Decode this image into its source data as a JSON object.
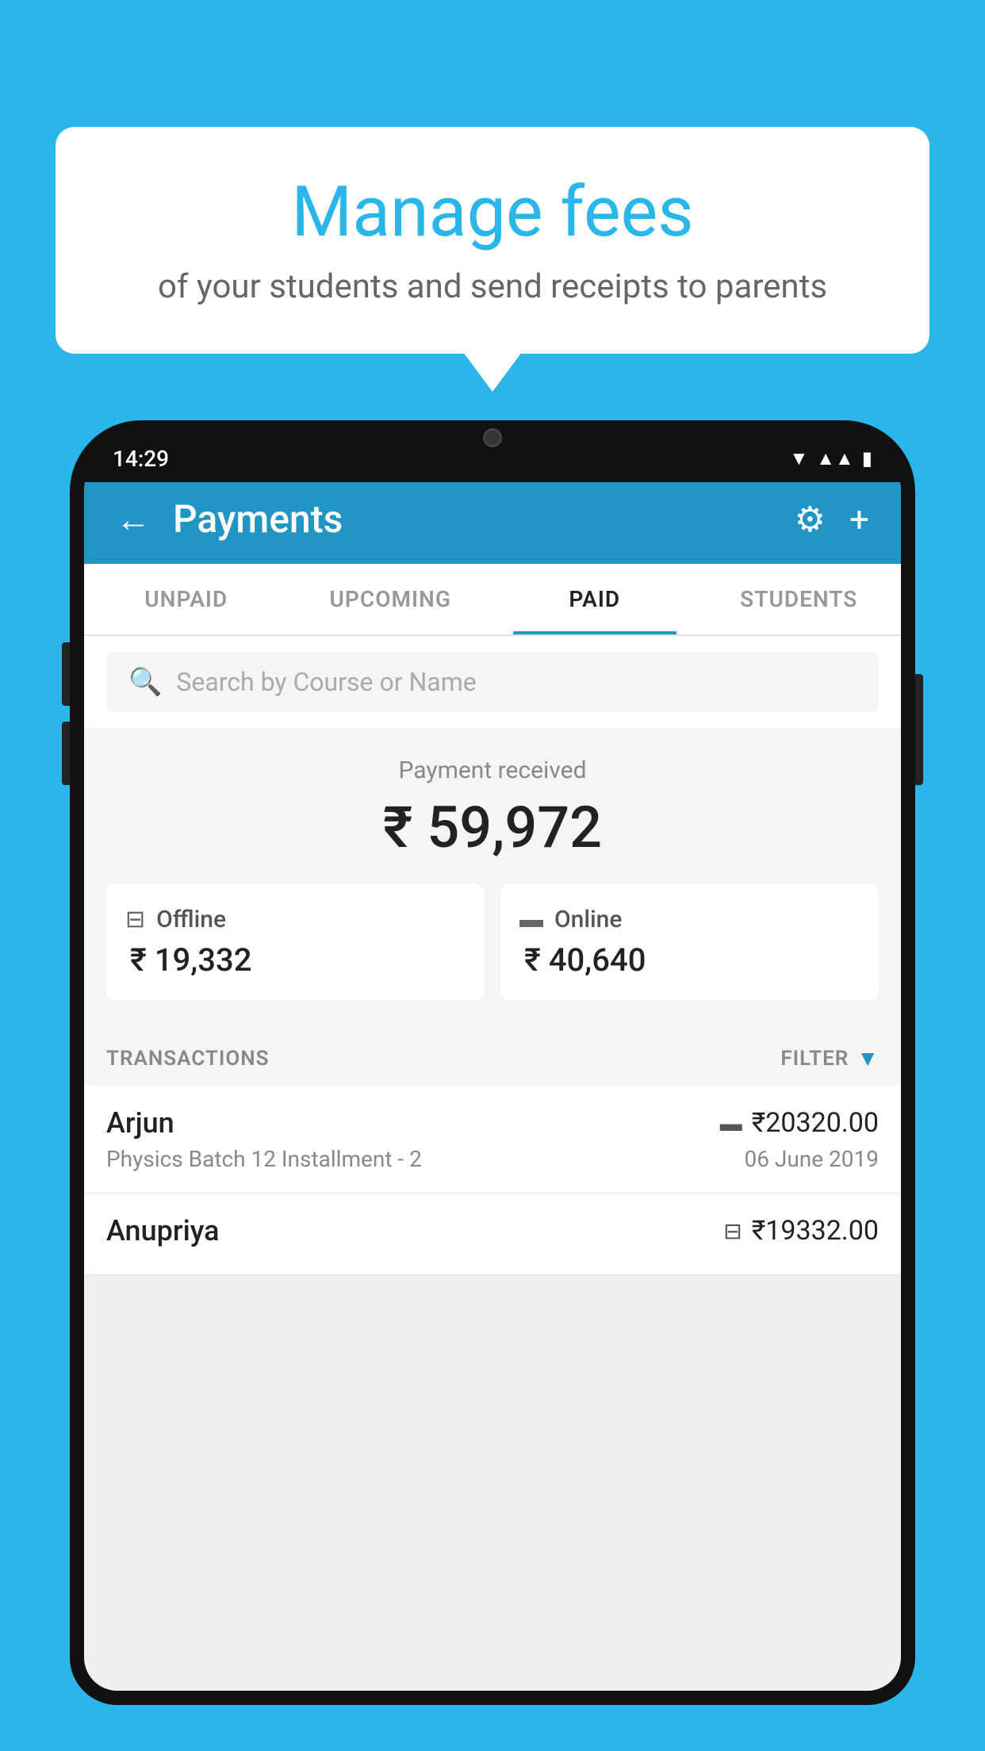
{
  "background_color": "#29b6e8",
  "speech_bubble": {
    "title": "Manage fees",
    "subtitle": "of your students and send receipts to parents"
  },
  "phone": {
    "status_time": "14:29",
    "header": {
      "title": "Payments",
      "back_label": "←",
      "gear_label": "⚙",
      "plus_label": "+"
    },
    "tabs": [
      {
        "label": "UNPAID",
        "active": false
      },
      {
        "label": "UPCOMING",
        "active": false
      },
      {
        "label": "PAID",
        "active": true
      },
      {
        "label": "STUDENTS",
        "active": false
      }
    ],
    "search": {
      "placeholder": "Search by Course or Name"
    },
    "payment_summary": {
      "label": "Payment received",
      "amount": "₹ 59,972",
      "offline": {
        "label": "Offline",
        "amount": "₹ 19,332"
      },
      "online": {
        "label": "Online",
        "amount": "₹ 40,640"
      }
    },
    "transactions_section": {
      "label": "TRANSACTIONS",
      "filter_label": "FILTER"
    },
    "transactions": [
      {
        "name": "Arjun",
        "amount": "₹20320.00",
        "course": "Physics Batch 12 Installment - 2",
        "date": "06 June 2019",
        "type": "online"
      },
      {
        "name": "Anupriya",
        "amount": "₹19332.00",
        "course": "",
        "date": "",
        "type": "offline"
      }
    ]
  }
}
